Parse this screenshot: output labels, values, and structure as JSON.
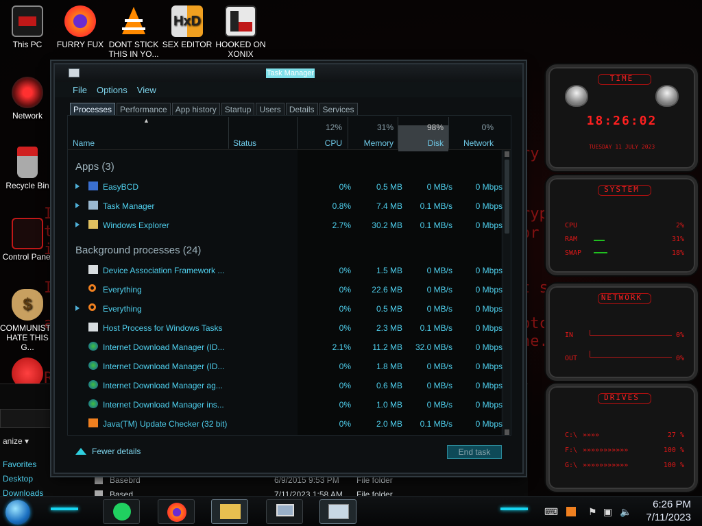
{
  "desktop_icons": [
    {
      "label": "This PC"
    },
    {
      "label": "FURRY FUX"
    },
    {
      "label": "DONT STICK THIS IN YO..."
    },
    {
      "label": "SEX EDITOR"
    },
    {
      "label": "HOOKED ON XONIX"
    },
    {
      "label": "Network"
    },
    {
      "label": "Recycle Bin"
    },
    {
      "label": "Control Panel"
    },
    {
      "label": "COMMUNISTS HATE THIS G..."
    }
  ],
  "bg_text": [
    "I",
    "th",
    "i",
    "I",
    "a",
    "R",
    "ry",
    "ryp",
    "or",
    "t s",
    "ptc",
    "ne."
  ],
  "taskmgr": {
    "title": "Task Manager",
    "menu": [
      "File",
      "Options",
      "View"
    ],
    "tabs": [
      "Processes",
      "Performance",
      "App history",
      "Startup",
      "Users",
      "Details",
      "Services"
    ],
    "columns": {
      "name": "Name",
      "status": "Status",
      "cpu_pct": "12%",
      "cpu": "CPU",
      "mem_pct": "31%",
      "mem": "Memory",
      "disk_pct": "98%",
      "disk": "Disk",
      "net_pct": "0%",
      "net": "Network"
    },
    "apps_header": "Apps (3)",
    "bg_header": "Background processes (24)",
    "apps": [
      {
        "name": "EasyBCD",
        "cpu": "0%",
        "mem": "0.5 MB",
        "disk": "0 MB/s",
        "net": "0 Mbps"
      },
      {
        "name": "Task Manager",
        "cpu": "0.8%",
        "mem": "7.4 MB",
        "disk": "0.1 MB/s",
        "net": "0 Mbps"
      },
      {
        "name": "Windows Explorer",
        "cpu": "2.7%",
        "mem": "30.2 MB",
        "disk": "0.1 MB/s",
        "net": "0 Mbps"
      }
    ],
    "background": [
      {
        "name": "Device Association Framework ...",
        "cpu": "0%",
        "mem": "1.5 MB",
        "disk": "0 MB/s",
        "net": "0 Mbps"
      },
      {
        "name": "Everything",
        "cpu": "0%",
        "mem": "22.6 MB",
        "disk": "0 MB/s",
        "net": "0 Mbps"
      },
      {
        "name": "Everything",
        "cpu": "0%",
        "mem": "0.5 MB",
        "disk": "0 MB/s",
        "net": "0 Mbps"
      },
      {
        "name": "Host Process for Windows Tasks",
        "cpu": "0%",
        "mem": "2.3 MB",
        "disk": "0.1 MB/s",
        "net": "0 Mbps"
      },
      {
        "name": "Internet Download Manager (ID...",
        "cpu": "2.1%",
        "mem": "11.2 MB",
        "disk": "32.0 MB/s",
        "net": "0 Mbps"
      },
      {
        "name": "Internet Download Manager (ID...",
        "cpu": "0%",
        "mem": "1.8 MB",
        "disk": "0 MB/s",
        "net": "0 Mbps"
      },
      {
        "name": "Internet Download Manager ag...",
        "cpu": "0%",
        "mem": "0.6 MB",
        "disk": "0 MB/s",
        "net": "0 Mbps"
      },
      {
        "name": "Internet Download Manager ins...",
        "cpu": "0%",
        "mem": "1.0 MB",
        "disk": "0 MB/s",
        "net": "0 Mbps"
      },
      {
        "name": "Java(TM) Update Checker (32 bit)",
        "cpu": "0%",
        "mem": "2.0 MB",
        "disk": "0.1 MB/s",
        "net": "0 Mbps"
      }
    ],
    "fewer_details": "Fewer details",
    "end_task": "End task"
  },
  "gadgets": {
    "time_title": "TIME",
    "time": "18:26:02",
    "date": "TUESDAY 11 JULY 2023",
    "system_title": "SYSTEM",
    "system": [
      {
        "label": "CPU",
        "value": "2%"
      },
      {
        "label": "RAM",
        "value": "31%"
      },
      {
        "label": "SWAP",
        "value": "18%"
      }
    ],
    "network_title": "NETWORK",
    "network": [
      {
        "label": "IN",
        "value": "0%"
      },
      {
        "label": "OUT",
        "value": "0%"
      }
    ],
    "drives_title": "DRIVES",
    "drives": [
      {
        "label": "C:\\",
        "value": "27 %"
      },
      {
        "label": "F:\\",
        "value": "100 %"
      },
      {
        "label": "G:\\",
        "value": "100 %"
      }
    ]
  },
  "explorer": {
    "organize": "anize",
    "favorites": [
      "Favorites",
      "Desktop",
      "Downloads"
    ],
    "files": [
      {
        "name": "Basebrd",
        "date": "6/9/2015 9:53 PM",
        "type": "File folder"
      },
      {
        "name": "Based",
        "date": "7/11/2023 1:58 AM",
        "type": "File folder"
      }
    ]
  },
  "taskbar": {
    "time": "6:26 PM",
    "date": "7/11/2023"
  }
}
